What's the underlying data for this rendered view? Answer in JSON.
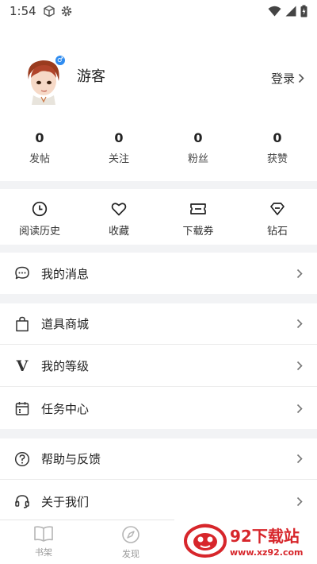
{
  "status_bar": {
    "time": "1:54",
    "icons": [
      "cube-icon",
      "settings-icon",
      "wifi-icon",
      "signal-icon",
      "battery-charging-icon"
    ]
  },
  "profile": {
    "username": "游客",
    "gender_symbol": "♂",
    "login_label": "登录"
  },
  "stats": [
    {
      "value": "0",
      "label": "发帖"
    },
    {
      "value": "0",
      "label": "关注"
    },
    {
      "value": "0",
      "label": "粉丝"
    },
    {
      "value": "0",
      "label": "获赞"
    }
  ],
  "quick_actions": [
    {
      "label": "阅读历史",
      "icon": "clock-icon"
    },
    {
      "label": "收藏",
      "icon": "heart-icon"
    },
    {
      "label": "下载券",
      "icon": "ticket-icon"
    },
    {
      "label": "钻石",
      "icon": "diamond-icon"
    }
  ],
  "menu": {
    "messages": "我的消息",
    "shop": "道具商城",
    "level": "我的等级",
    "level_icon_text": "V",
    "tasks": "任务中心",
    "help": "帮助与反馈",
    "about": "关于我们"
  },
  "tabbar": [
    {
      "label": "书架",
      "icon": "book-icon"
    },
    {
      "label": "发现",
      "icon": "compass-icon"
    }
  ],
  "watermark": {
    "title": "92下载站",
    "url": "www.xz92.com"
  },
  "colors": {
    "accent_blue": "#2f8cf0",
    "watermark_red": "#d7262b",
    "divider": "#f2f3f5"
  }
}
